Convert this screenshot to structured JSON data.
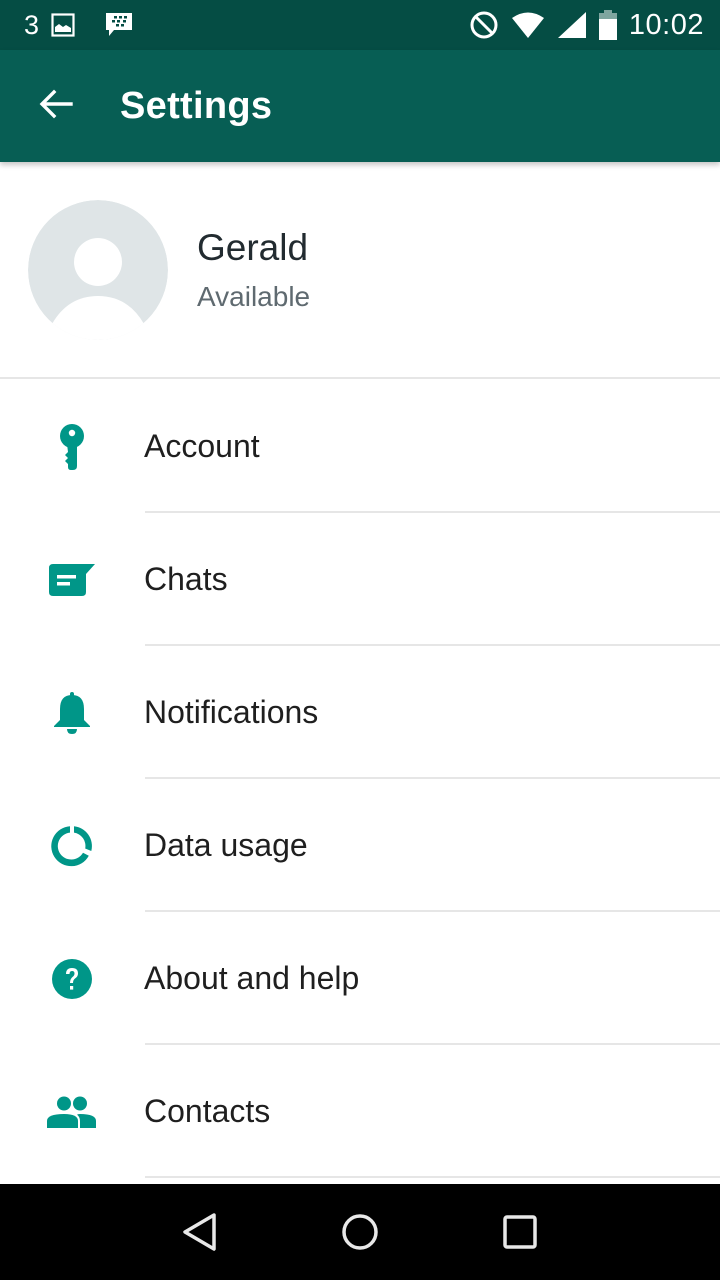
{
  "status_bar": {
    "notification_count": "3",
    "left_icons": [
      "image-icon",
      "bbm-icon"
    ],
    "right_icons": [
      "do-not-disturb-icon",
      "wifi-icon",
      "cellular-signal-icon",
      "battery-icon"
    ],
    "time": "10:02"
  },
  "app_bar": {
    "back_icon": "arrow-left-icon",
    "title": "Settings"
  },
  "profile": {
    "name": "Gerald",
    "status": "Available",
    "avatar_icon": "default-avatar-icon"
  },
  "menu": {
    "items": [
      {
        "label": "Account",
        "icon": "key-icon"
      },
      {
        "label": "Chats",
        "icon": "chat-icon"
      },
      {
        "label": "Notifications",
        "icon": "bell-icon"
      },
      {
        "label": "Data usage",
        "icon": "data-usage-icon"
      },
      {
        "label": "About and help",
        "icon": "help-icon"
      },
      {
        "label": "Contacts",
        "icon": "contacts-icon"
      }
    ]
  },
  "nav_bar": {
    "back": "back-triangle-icon",
    "home": "home-circle-icon",
    "recents": "recents-square-icon"
  },
  "colors": {
    "status_bar": "#054d44",
    "app_bar": "#075e54",
    "accent": "#009688",
    "avatar_bg": "#dfe5e7"
  }
}
